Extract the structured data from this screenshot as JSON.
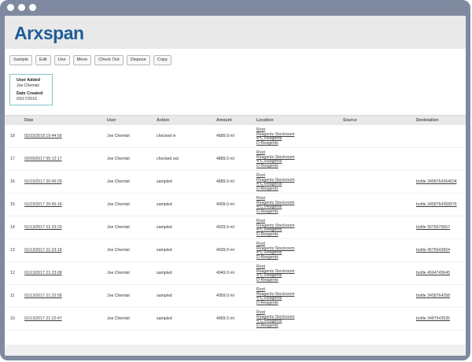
{
  "app": {
    "logo_text": "Arxspan"
  },
  "toolbar": {
    "buttons": [
      "Sample",
      "Edit",
      "Use",
      "Move",
      "Check Out",
      "Dispose",
      "Copy"
    ]
  },
  "info": {
    "user_added_label": "User Added",
    "user_added_value": "Joe Chemist",
    "date_created_label": "Date Created",
    "date_created_value": "03/17/2016"
  },
  "table": {
    "headers": [
      "Date",
      "User",
      "Action",
      "Amount",
      "Location",
      "Source",
      "Destination"
    ],
    "rows": [
      {
        "num": "18",
        "date": "02/23/2018 19:44:56",
        "user": "Joe Chemist",
        "action": "checked in",
        "amount": "4889.0 ml",
        "location": [
          "Root",
          "Reagents Stockroom",
          "4°C Reagents",
          "D-Reagents"
        ],
        "source": "",
        "destination": ""
      },
      {
        "num": "17",
        "date": "02/09/2017 05:12:17",
        "user": "Joe Chemist",
        "action": "checked out",
        "amount": "4889.0 ml",
        "location": [
          "Root",
          "Reagents Stockroom",
          "4°C Reagents",
          "D-Reagents"
        ],
        "source": "",
        "destination": ""
      },
      {
        "num": "16",
        "date": "01/23/2017 20:45:29",
        "user": "Joe Chemist",
        "action": "sampled",
        "amount": "4889.0 ml",
        "location": [
          "Root",
          "Reagents Stockroom",
          "4°C Reagents",
          "D-Reagents"
        ],
        "source": "",
        "destination": "bottle 3458764364634"
      },
      {
        "num": "15",
        "date": "01/23/2017 20:45:18",
        "user": "Joe Chemist",
        "action": "sampled",
        "amount": "4909.0 ml",
        "location": [
          "Root",
          "Reagents Stockroom",
          "4°C Reagents",
          "D-Reagents"
        ],
        "source": "",
        "destination": "bottle 3458764358976"
      },
      {
        "num": "14",
        "date": "01/13/2017 21:23:29",
        "user": "Joe Chemist",
        "action": "sampled",
        "amount": "4929.0 ml",
        "location": [
          "Root",
          "Reagents Stockroom",
          "4°C Reagents",
          "D-Reagents"
        ],
        "source": "",
        "destination": "bottle 5675675667"
      },
      {
        "num": "13",
        "date": "01/13/2017 21:23:18",
        "user": "Joe Chemist",
        "action": "sampled",
        "amount": "4939.0 ml",
        "location": [
          "Root",
          "Reagents Stockroom",
          "4°C Reagents",
          "D-Reagents"
        ],
        "source": "",
        "destination": "bottle 4575643654"
      },
      {
        "num": "12",
        "date": "01/13/2017 21:23:08",
        "user": "Joe Chemist",
        "action": "sampled",
        "amount": "4949.0 ml",
        "location": [
          "Root",
          "Reagents Stockroom",
          "4°C Reagents",
          "D-Reagents"
        ],
        "source": "",
        "destination": "bottle 4564745645"
      },
      {
        "num": "11",
        "date": "01/13/2017 21:22:58",
        "user": "Joe Chemist",
        "action": "sampled",
        "amount": "4959.0 ml",
        "location": [
          "Root",
          "Reagents Stockroom",
          "4°C Reagents",
          "D-Reagents"
        ],
        "source": "",
        "destination": "bottle 3458764358"
      },
      {
        "num": "10",
        "date": "01/13/2017 21:22:47",
        "user": "Joe Chemist",
        "action": "sampled",
        "amount": "4969.0 ml",
        "location": [
          "Root",
          "Reagents Stockroom",
          "4°C Reagents",
          "D-Reagents"
        ],
        "source": "",
        "destination": "bottle 3487543535"
      }
    ]
  },
  "colors": {
    "window_frame": "#7f8aa0",
    "logo": "#1f5d97",
    "card_border": "#7ec4c9",
    "header_row": "#e8e8e8"
  }
}
